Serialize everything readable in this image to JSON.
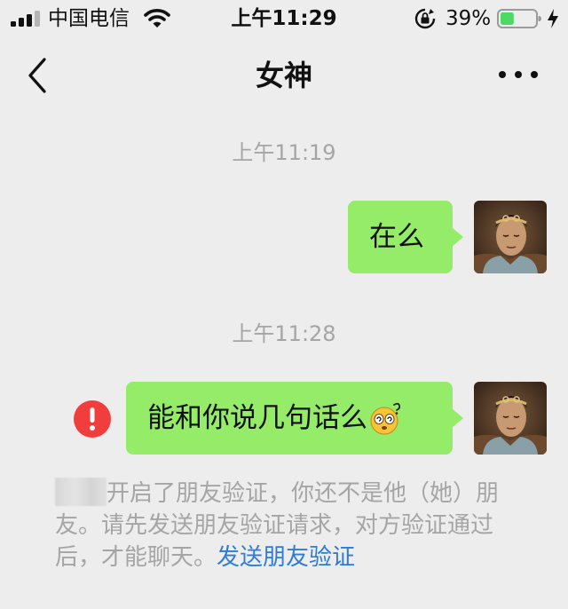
{
  "status_bar": {
    "carrier": "中国电信",
    "time": "上午11:29",
    "battery_percent": "39%",
    "battery_level": 0.39,
    "battery_color": "#4cd964",
    "icons": [
      "signal-icon",
      "wifi-icon",
      "rotation-lock-icon",
      "battery-icon",
      "charging-bolt-icon"
    ]
  },
  "nav": {
    "title": "女神",
    "back_icon": "chevron-left-icon",
    "more_icon": "more-dots-icon"
  },
  "messages": [
    {
      "timestamp": "上午11:19",
      "text": "在么",
      "sender": "self"
    },
    {
      "timestamp": "上午11:28",
      "text": "能和你说几句话么",
      "emoji": "dizzy-face-emoji",
      "sender": "self",
      "failed": true,
      "status_icon": "error-exclamation-icon"
    }
  ],
  "notice": {
    "text": "开启了朋友验证，你还不是他（她）朋友。请先发送朋友验证请求，对方验证通过后，才能聊天。",
    "link_label": "发送朋友验证"
  },
  "colors": {
    "background": "#ededed",
    "bubble": "#95ec69",
    "error": "#f23d3d",
    "link": "#2f7bd6",
    "meta_text": "#a5a5a5"
  }
}
